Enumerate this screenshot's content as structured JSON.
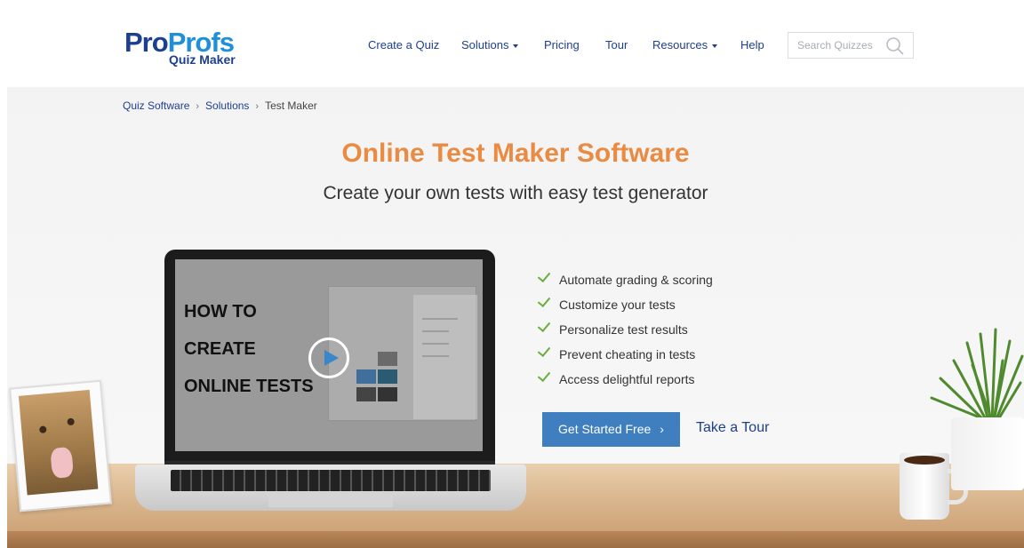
{
  "header": {
    "logo": {
      "part1": "Pro",
      "part2": "Profs",
      "sub": "Quiz Maker"
    },
    "nav": [
      {
        "label": "Create a Quiz",
        "dropdown": false
      },
      {
        "label": "Solutions",
        "dropdown": true
      },
      {
        "label": "Pricing",
        "dropdown": false
      },
      {
        "label": "Tour",
        "dropdown": false
      },
      {
        "label": "Resources",
        "dropdown": true
      },
      {
        "label": "Help",
        "dropdown": false
      }
    ],
    "search": {
      "placeholder": "Search Quizzes",
      "icon": "search-icon"
    }
  },
  "breadcrumb": {
    "items": [
      "Quiz Software",
      "Solutions",
      "Test Maker"
    ],
    "separator": "›"
  },
  "hero": {
    "title": "Online Test Maker Software",
    "subtitle": "Create your own tests with easy test generator",
    "video": {
      "lines": [
        "HOW TO",
        "CREATE",
        "ONLINE TESTS"
      ],
      "icon": "play-icon"
    },
    "features": [
      "Automate grading & scoring",
      "Customize your tests",
      "Personalize test results",
      "Prevent cheating in tests",
      "Access delightful reports"
    ],
    "cta_label": "Get Started Free",
    "tour_label": "Take a Tour"
  },
  "colors": {
    "brand_navy": "#1d3f8f",
    "brand_blue": "#1e8fd8",
    "title_orange": "#e98b43",
    "cta_blue": "#3f7fbf",
    "check_green": "#6cae3e"
  }
}
